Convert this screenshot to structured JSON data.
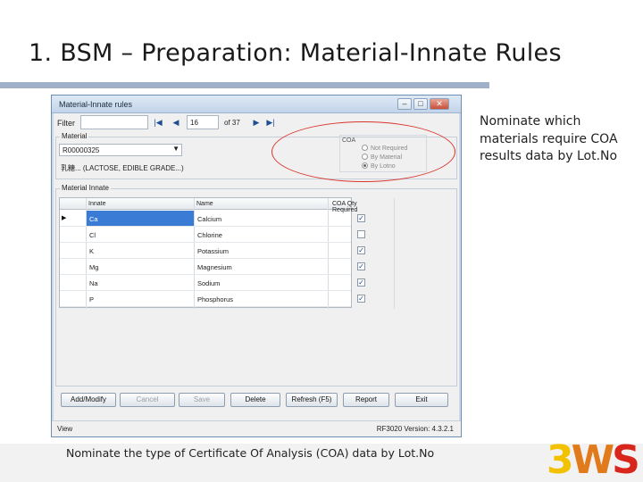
{
  "slide": {
    "title": "1. BSM – Preparation: Material-Innate Rules",
    "side_note": "Nominate which materials require COA results data by Lot.No",
    "caption": "Nominate the type of Certificate Of Analysis (COA) data by Lot.No",
    "logo": {
      "part1": "3",
      "part2": "W",
      "part3": "S",
      "colors": [
        "#f2c200",
        "#e07a1a",
        "#d8261d"
      ]
    },
    "highlight_color": "#d9342b"
  },
  "window": {
    "title": "Material-Innate rules",
    "controls": {
      "minimize": "–",
      "maximize": "□",
      "close": "✕"
    },
    "filter": {
      "label": "Filter",
      "value": ""
    },
    "pager": {
      "first": "|◀",
      "prev": "◀",
      "page": "16",
      "of": "of 37",
      "next": "▶",
      "last": "▶|"
    },
    "material": {
      "group_label": "Material",
      "code": "R00000325",
      "description": "乳糖... (LACTOSE, EDIBLE GRADE...)"
    },
    "coa": {
      "caption": "COA",
      "options": [
        {
          "label": "Not Required",
          "selected": false
        },
        {
          "label": "By Material",
          "selected": false
        },
        {
          "label": "By Lotno",
          "selected": true
        }
      ]
    },
    "innate": {
      "group_label": "Material Innate",
      "columns": [
        "Innate",
        "Name",
        "COA Qty Required"
      ],
      "rows": [
        {
          "innate": "Ca",
          "name": "Calcium",
          "required": true,
          "selected": true
        },
        {
          "innate": "Cl",
          "name": "Chlorine",
          "required": false,
          "selected": false
        },
        {
          "innate": "K",
          "name": "Potassium",
          "required": true,
          "selected": false
        },
        {
          "innate": "Mg",
          "name": "Magnesium",
          "required": true,
          "selected": false
        },
        {
          "innate": "Na",
          "name": "Sodium",
          "required": true,
          "selected": false
        },
        {
          "innate": "P",
          "name": "Phosphorus",
          "required": true,
          "selected": false
        }
      ]
    },
    "buttons": {
      "add_modify": "Add/Modify",
      "cancel": "Cancel",
      "save": "Save",
      "delete": "Delete",
      "refresh": "Refresh (F5)",
      "report": "Report",
      "exit": "Exit"
    },
    "status": {
      "left": "View",
      "right": "RF3020 Version: 4.3.2.1"
    }
  }
}
